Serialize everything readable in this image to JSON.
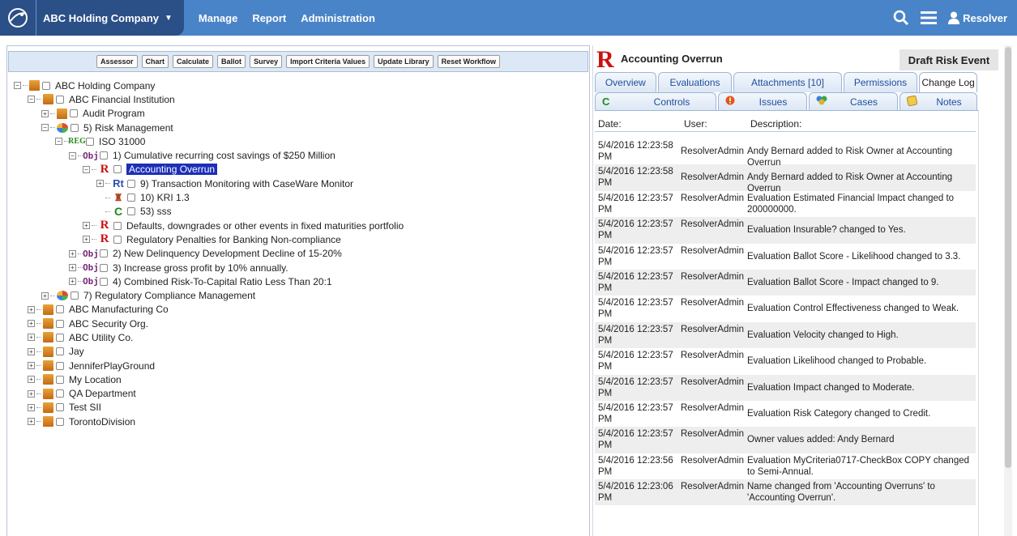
{
  "topbar": {
    "company": "ABC Holding Company",
    "nav": [
      "Manage",
      "Report",
      "Administration"
    ],
    "user": "Resolver"
  },
  "toolbar": {
    "buttons": [
      "Assessor",
      "Chart",
      "Calculate",
      "Ballot",
      "Survey",
      "Import Criteria Values",
      "Update Library",
      "Reset Workflow"
    ]
  },
  "tree": [
    {
      "label": "ABC Holding Company",
      "icon": "building-icon"
    },
    {
      "label": "ABC Financial Institution",
      "icon": "building-icon"
    },
    {
      "label": "Audit Program",
      "icon": "building-icon"
    },
    {
      "label": "5) Risk Management",
      "icon": "risk-management-icon"
    },
    {
      "label": "ISO 31000",
      "icon": "regulation-icon",
      "icon_text": "REG"
    },
    {
      "label": "1) Cumulative recurring cost savings of $250 Million",
      "icon": "objective-icon",
      "icon_text": "Obj"
    },
    {
      "label": "Accounting Overrun",
      "icon": "risk-icon",
      "icon_text": "R"
    },
    {
      "label": "9) Transaction Monitoring with CaseWare Monitor",
      "icon": "risk-treatment-icon",
      "icon_text": "Rt"
    },
    {
      "label": "10) KRI 1.3",
      "icon": "kri-icon"
    },
    {
      "label": "53) sss",
      "icon": "control-icon",
      "icon_text": "C"
    },
    {
      "label": "Defaults, downgrades or other events in fixed maturities portfolio",
      "icon": "risk-icon",
      "icon_text": "R"
    },
    {
      "label": "Regulatory Penalties for Banking Non-compliance",
      "icon": "risk-icon",
      "icon_text": "R"
    },
    {
      "label": "2) New Delinquency Development Decline of 15-20%",
      "icon": "objective-icon",
      "icon_text": "Obj"
    },
    {
      "label": "3) Increase gross profit by 10% annually.",
      "icon": "objective-icon",
      "icon_text": "Obj"
    },
    {
      "label": "4) Combined Risk-To-Capital Ratio Less Than 20:1",
      "icon": "objective-icon",
      "icon_text": "Obj"
    },
    {
      "label": "7) Regulatory Compliance Management",
      "icon": "risk-management-icon"
    },
    {
      "label": "ABC Manufacturing Co",
      "icon": "building-icon"
    },
    {
      "label": "ABC Security Org.",
      "icon": "building-icon"
    },
    {
      "label": "ABC Utility Co.",
      "icon": "building-icon"
    },
    {
      "label": "Jay",
      "icon": "building-icon"
    },
    {
      "label": "JenniferPlayGround",
      "icon": "building-icon"
    },
    {
      "label": "My Location",
      "icon": "building-icon"
    },
    {
      "label": "QA Department",
      "icon": "building-icon"
    },
    {
      "label": "Test SII",
      "icon": "building-icon"
    },
    {
      "label": "TorontoDivision",
      "icon": "building-icon"
    }
  ],
  "detail": {
    "title": "Accounting Overrun",
    "status": "Draft Risk Event",
    "tabs": [
      "Overview",
      "Evaluations",
      "Attachments [10]",
      "Permissions",
      "Change Log"
    ],
    "active_tab": "Change Log",
    "subtabs": [
      "Controls",
      "Issues",
      "Cases",
      "Notes"
    ],
    "columns": {
      "date": "Date:",
      "user": "User:",
      "description": "Description:"
    },
    "log": [
      {
        "date": "5/4/2016 12:23:58 PM",
        "user": "ResolverAdmin",
        "desc": "Andy Bernard added to Risk Owner at Accounting Overrun"
      },
      {
        "date": "5/4/2016 12:23:58 PM",
        "user": "ResolverAdmin",
        "desc": "Andy Bernard added to Risk Owner at Accounting Overrun"
      },
      {
        "date": "5/4/2016 12:23:57 PM",
        "user": "ResolverAdmin",
        "desc": "Evaluation Estimated Financial Impact changed to 200000000."
      },
      {
        "date": "5/4/2016 12:23:57 PM",
        "user": "ResolverAdmin",
        "desc": "Evaluation Insurable? changed to Yes."
      },
      {
        "date": "5/4/2016 12:23:57 PM",
        "user": "ResolverAdmin",
        "desc": "Evaluation Ballot Score - Likelihood changed to 3.3."
      },
      {
        "date": "5/4/2016 12:23:57 PM",
        "user": "ResolverAdmin",
        "desc": "Evaluation Ballot Score - Impact changed to 9."
      },
      {
        "date": "5/4/2016 12:23:57 PM",
        "user": "ResolverAdmin",
        "desc": "Evaluation Control Effectiveness changed to Weak."
      },
      {
        "date": "5/4/2016 12:23:57 PM",
        "user": "ResolverAdmin",
        "desc": "Evaluation Velocity changed to High."
      },
      {
        "date": "5/4/2016 12:23:57 PM",
        "user": "ResolverAdmin",
        "desc": "Evaluation Likelihood changed to Probable."
      },
      {
        "date": "5/4/2016 12:23:57 PM",
        "user": "ResolverAdmin",
        "desc": "Evaluation Impact changed to Moderate."
      },
      {
        "date": "5/4/2016 12:23:57 PM",
        "user": "ResolverAdmin",
        "desc": "Evaluation Risk Category changed to Credit."
      },
      {
        "date": "5/4/2016 12:23:57 PM",
        "user": "ResolverAdmin",
        "desc": "Owner values added: Andy Bernard"
      },
      {
        "date": "5/4/2016 12:23:56 PM",
        "user": "ResolverAdmin",
        "desc": "Evaluation MyCriteria0717-CheckBox COPY changed to Semi-Annual."
      },
      {
        "date": "5/4/2016 12:23:06 PM",
        "user": "ResolverAdmin",
        "desc": "Name changed from 'Accounting Overruns' to 'Accounting Overrun'."
      }
    ]
  },
  "colors": {
    "nav": "#4a84c8",
    "nav_dark": "#2b4f87",
    "selection": "#1c2fb8",
    "risk": "#cc1010"
  }
}
